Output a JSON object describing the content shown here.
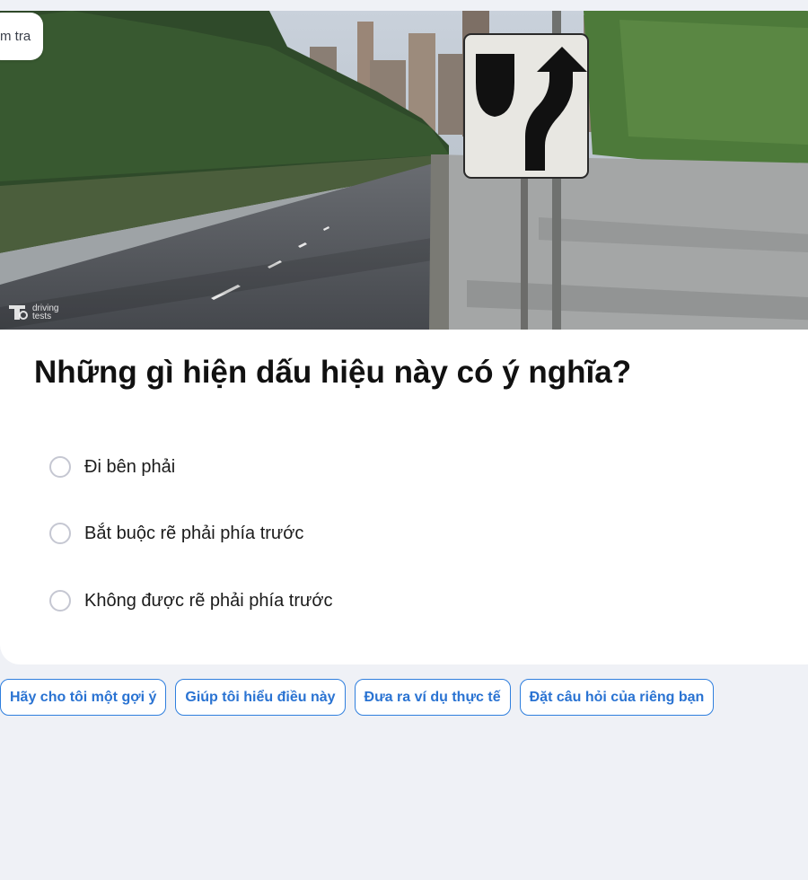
{
  "header": {
    "tag_label": "m tra"
  },
  "image": {
    "brand_text": "driving tests",
    "sign_icon": "keep-right-sign-icon"
  },
  "question": {
    "text": "Những gì hiện dấu hiệu này có ý nghĩa?"
  },
  "options": [
    {
      "label": "Đi bên phải",
      "selected": false
    },
    {
      "label": "Bắt buộc rẽ phải phía trước",
      "selected": false
    },
    {
      "label": "Không được rẽ phải phía trước",
      "selected": false
    }
  ],
  "assist": [
    {
      "label": "Hãy cho tôi một gợi ý"
    },
    {
      "label": "Giúp tôi hiểu điều này"
    },
    {
      "label": "Đưa ra ví dụ thực tế"
    },
    {
      "label": "Đặt câu hỏi của riêng bạn"
    }
  ],
  "colors": {
    "accent": "#2f7fde",
    "page_bg": "#eff1f6",
    "card_bg": "#ffffff"
  }
}
